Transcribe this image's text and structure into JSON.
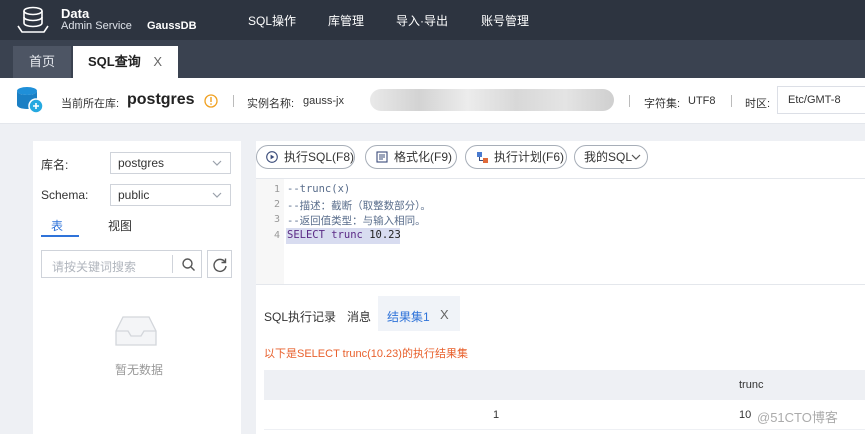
{
  "brand": {
    "line1": "Data",
    "line2": "Admin Service",
    "product": "GaussDB"
  },
  "nav": [
    "SQL操作",
    "库管理",
    "导入·导出",
    "账号管理"
  ],
  "tabs": {
    "home": "首页",
    "sql": "SQL查询",
    "close": "X"
  },
  "info": {
    "current_db_label": "当前所在库:",
    "current_db": "postgres",
    "instance_label": "实例名称:",
    "instance": "gauss-jx",
    "charset_label": "字符集:",
    "charset": "UTF8",
    "timezone_label": "时区:",
    "timezone": "Etc/GMT-8"
  },
  "left": {
    "db_label": "库名:",
    "db_value": "postgres",
    "schema_label": "Schema:",
    "schema_value": "public",
    "tab_table": "表",
    "tab_view": "视图",
    "search_placeholder": "请按关键词搜索",
    "empty": "暂无数据"
  },
  "toolbar": {
    "execute": "执行SQL(F8)",
    "format": "格式化(F9)",
    "plan": "执行计划(F6)",
    "my_sql": "我的SQL"
  },
  "editor": {
    "line_numbers": [
      "1",
      "2",
      "3",
      "4"
    ],
    "line1": "--trunc(x)",
    "line2": "--描述：截断（取整数部分）。",
    "line3": "--返回值类型：与输入相同。",
    "line4_kw": "SELECT",
    "line4_fn": " trunc",
    "line4_arg": " 10.23"
  },
  "results": {
    "tab_history": "SQL执行记录",
    "tab_messages": "消息",
    "tab_result": "结果集1",
    "close": "X",
    "message": "以下是SELECT trunc(10.23)的执行结果集",
    "column": "trunc",
    "row_num": "1",
    "row_value": "10"
  },
  "watermark": "@51CTO博客",
  "colors": {
    "topbar": "#2d3440",
    "accent": "#2f73d9",
    "warning": "#e8602c"
  }
}
